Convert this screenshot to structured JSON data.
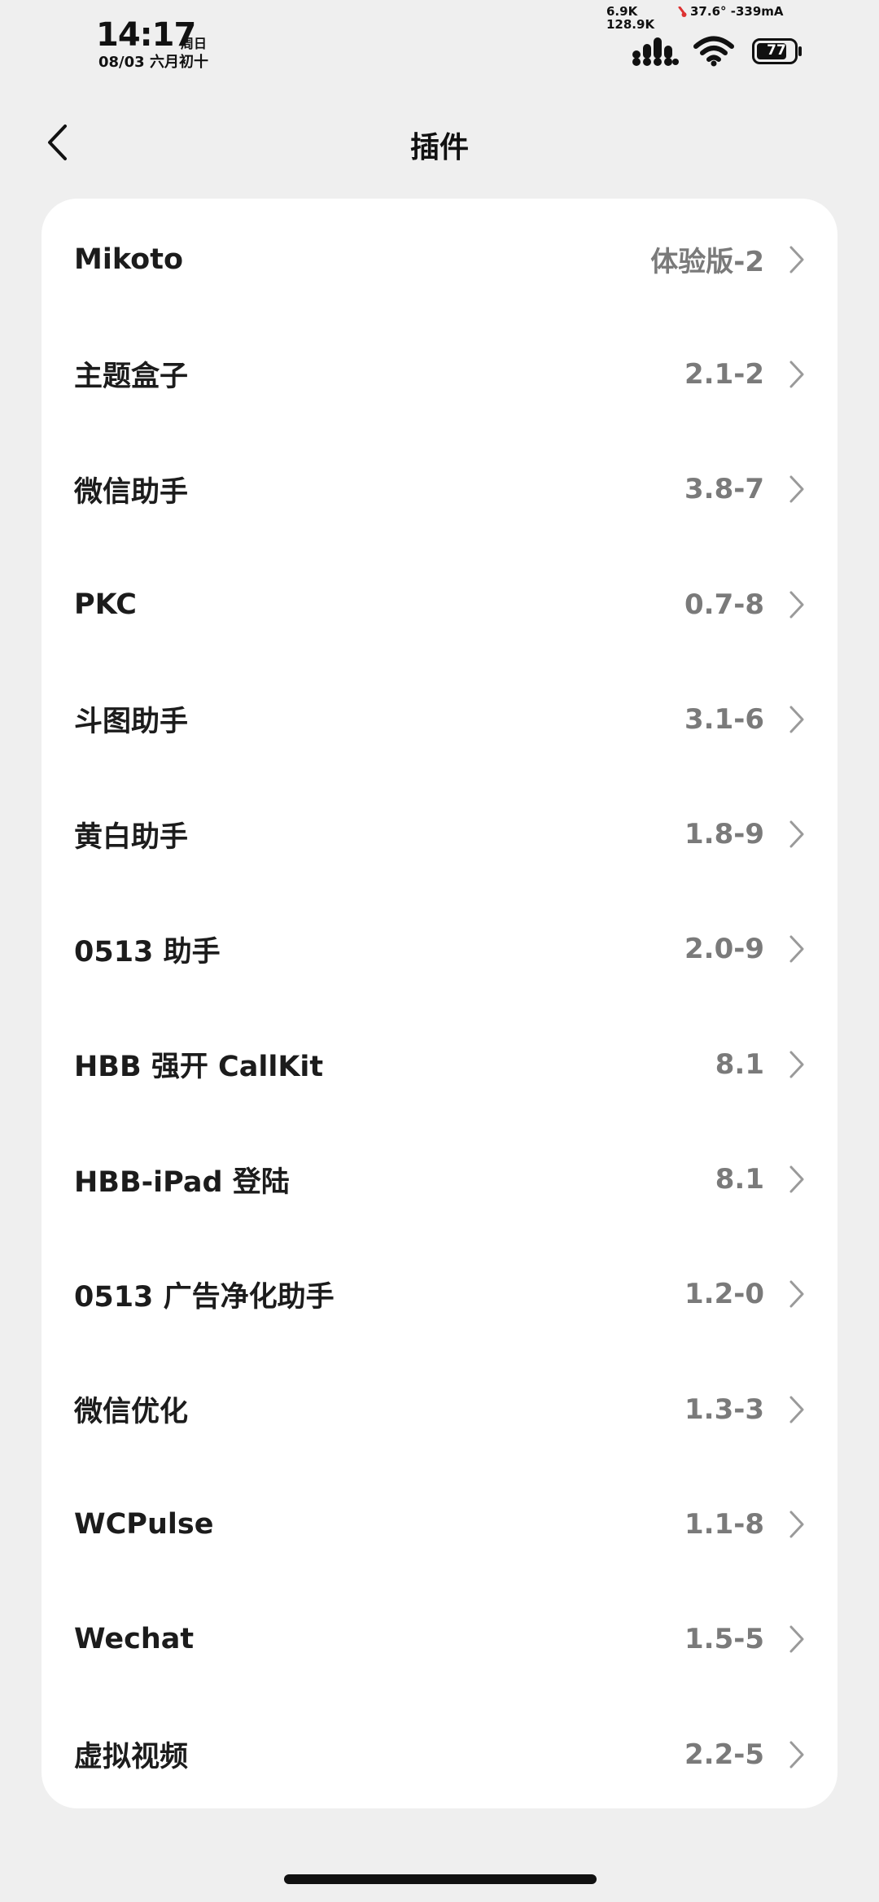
{
  "status_bar": {
    "time": "14:17",
    "weekday": "周日",
    "date": "08/03 六月初十",
    "net_down": "6.9K",
    "net_up": "128.9K",
    "temp_current": "37.6° -339mA",
    "battery": "77"
  },
  "nav": {
    "title": "插件"
  },
  "plugins": [
    {
      "label": "Mikoto",
      "value": "体验版-2"
    },
    {
      "label": "主题盒子",
      "value": "2.1-2"
    },
    {
      "label": "微信助手",
      "value": "3.8-7"
    },
    {
      "label": "PKC",
      "value": "0.7-8"
    },
    {
      "label": "斗图助手",
      "value": "3.1-6"
    },
    {
      "label": "黄白助手",
      "value": "1.8-9"
    },
    {
      "label": "0513 助手",
      "value": "2.0-9"
    },
    {
      "label": "HBB 强开 CallKit",
      "value": "8.1"
    },
    {
      "label": "HBB-iPad 登陆",
      "value": "8.1"
    },
    {
      "label": "0513 广告净化助手",
      "value": "1.2-0"
    },
    {
      "label": "微信优化",
      "value": "1.3-3"
    },
    {
      "label": "WCPulse",
      "value": "1.1-8"
    },
    {
      "label": "Wechat",
      "value": "1.5-5"
    },
    {
      "label": "虚拟视频",
      "value": "2.2-5"
    }
  ],
  "icons": {
    "back": "chevron-left-icon",
    "row_arrow": "chevron-right-icon",
    "signal": "signal-icon",
    "wifi": "wifi-icon",
    "battery": "battery-icon",
    "temperature": "thermometer-icon"
  },
  "colors": {
    "background": "#efefef",
    "card": "#ffffff",
    "label": "#1c1c1c",
    "value": "#7a7a7a",
    "chevron": "#9a9a9a"
  }
}
